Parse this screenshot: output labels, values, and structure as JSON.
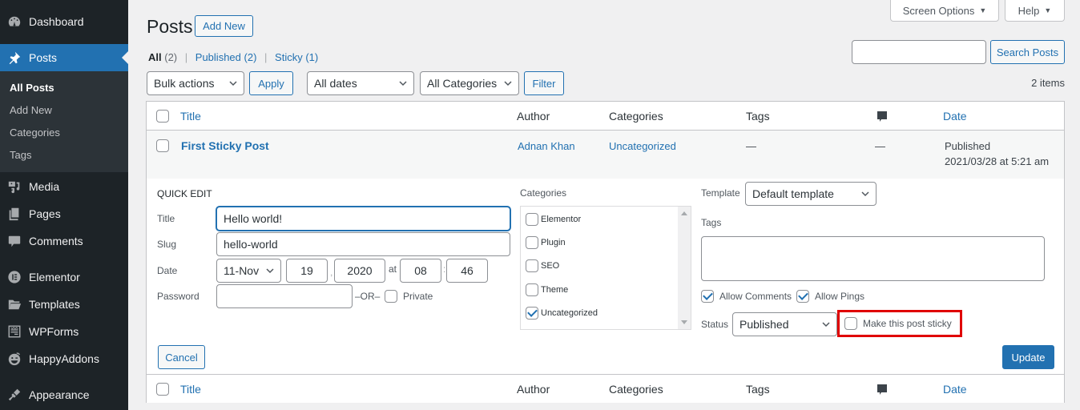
{
  "sidebar": {
    "items": [
      {
        "label": "Dashboard",
        "icon": "dashboard-icon"
      },
      {
        "label": "Posts",
        "icon": "pin-icon",
        "current": true
      },
      {
        "label": "Media",
        "icon": "media-icon"
      },
      {
        "label": "Pages",
        "icon": "pages-icon"
      },
      {
        "label": "Comments",
        "icon": "comment-icon"
      },
      {
        "label": "Elementor",
        "icon": "elementor-icon"
      },
      {
        "label": "Templates",
        "icon": "folder-icon"
      },
      {
        "label": "WPForms",
        "icon": "form-icon"
      },
      {
        "label": "HappyAddons",
        "icon": "happy-face-icon"
      },
      {
        "label": "Appearance",
        "icon": "paintbrush-icon"
      }
    ],
    "submenu": [
      "All Posts",
      "Add New",
      "Categories",
      "Tags"
    ]
  },
  "header": {
    "title": "Posts",
    "add_new": "Add New",
    "screen_options": "Screen Options",
    "help": "Help",
    "caret": "▼"
  },
  "views": {
    "all": "All",
    "all_count": "(2)",
    "published": "Published",
    "published_count": "(2)",
    "sticky": "Sticky",
    "sticky_count": "(1)",
    "separator": "|"
  },
  "search": {
    "value": "",
    "button": "Search Posts"
  },
  "filters": {
    "bulk_actions": "Bulk actions",
    "apply": "Apply",
    "dates": "All dates",
    "categories": "All Categories",
    "filter": "Filter",
    "items_count": "2 items"
  },
  "table": {
    "columns": {
      "title": "Title",
      "author": "Author",
      "categories": "Categories",
      "tags": "Tags",
      "comments_icon": "comment-bubble-icon",
      "date": "Date"
    },
    "rows": [
      {
        "title": "First Sticky Post",
        "author": "Adnan Khan",
        "categories": "Uncategorized",
        "tags": "—",
        "comments": "—",
        "date_status": "Published",
        "date": "2021/03/28 at 5:21 am"
      }
    ]
  },
  "quick_edit": {
    "heading": "QUICK EDIT",
    "title_label": "Title",
    "title_value": "Hello world!",
    "slug_label": "Slug",
    "slug_value": "hello-world",
    "date_label": "Date",
    "month": "11-Nov",
    "day": "19",
    "comma": ",",
    "year": "2020",
    "at": "at",
    "hour": "08",
    "colon": ":",
    "minute": "46",
    "password_label": "Password",
    "password_value": "",
    "or": "–OR–",
    "private_label": "Private",
    "private_checked": false,
    "categories_label": "Categories",
    "categories": [
      {
        "label": "Elementor",
        "checked": false
      },
      {
        "label": "Plugin",
        "checked": false
      },
      {
        "label": "SEO",
        "checked": false
      },
      {
        "label": "Theme",
        "checked": false
      },
      {
        "label": "Uncategorized",
        "checked": true
      }
    ],
    "template_label": "Template",
    "template_value": "Default template",
    "tags_label": "Tags",
    "tags_value": "",
    "allow_comments": "Allow Comments",
    "allow_comments_checked": true,
    "allow_pings": "Allow Pings",
    "allow_pings_checked": true,
    "status_label": "Status",
    "status_value": "Published",
    "sticky_label": "Make this post sticky",
    "sticky_checked": false,
    "highlight_color": "#e00000",
    "cancel": "Cancel",
    "update": "Update"
  },
  "colors": {
    "accent": "#2271b1",
    "sidebar_bg": "#1d2327",
    "submenu_bg": "#2c3338",
    "page_bg": "#f0f0f1"
  }
}
